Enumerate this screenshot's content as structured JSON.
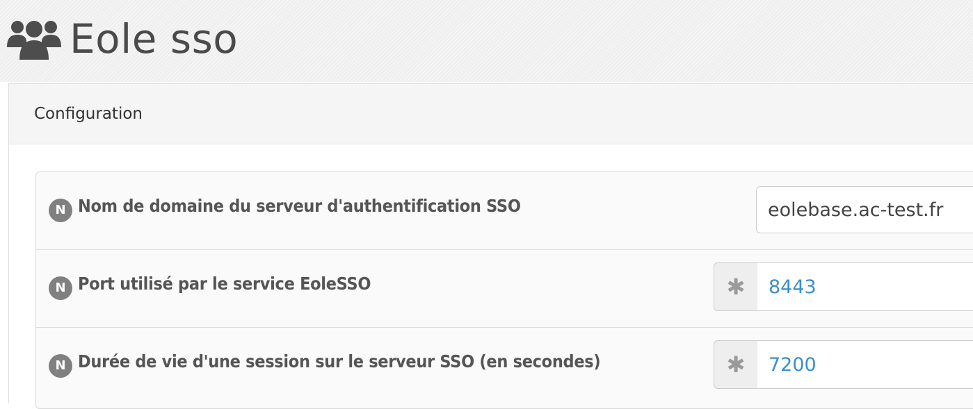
{
  "header": {
    "icon": "users-icon",
    "title": "Eole sso"
  },
  "panel": {
    "title": "Configuration",
    "fields": [
      {
        "badge": "N",
        "label": "Nom de domaine du serveur d'authentification SSO",
        "value": "eolebase.ac-test.fr"
      },
      {
        "badge": "N",
        "label": "Port utilisé par le service EoleSSO",
        "addon": "✱",
        "value": "8443"
      },
      {
        "badge": "N",
        "label": "Durée de vie d'une session sur le serveur SSO (en secondes)",
        "addon": "✱",
        "value": "7200"
      }
    ]
  },
  "colors": {
    "badge": "#808080",
    "value_text": "#3a8fc6",
    "label_text": "#555555"
  }
}
